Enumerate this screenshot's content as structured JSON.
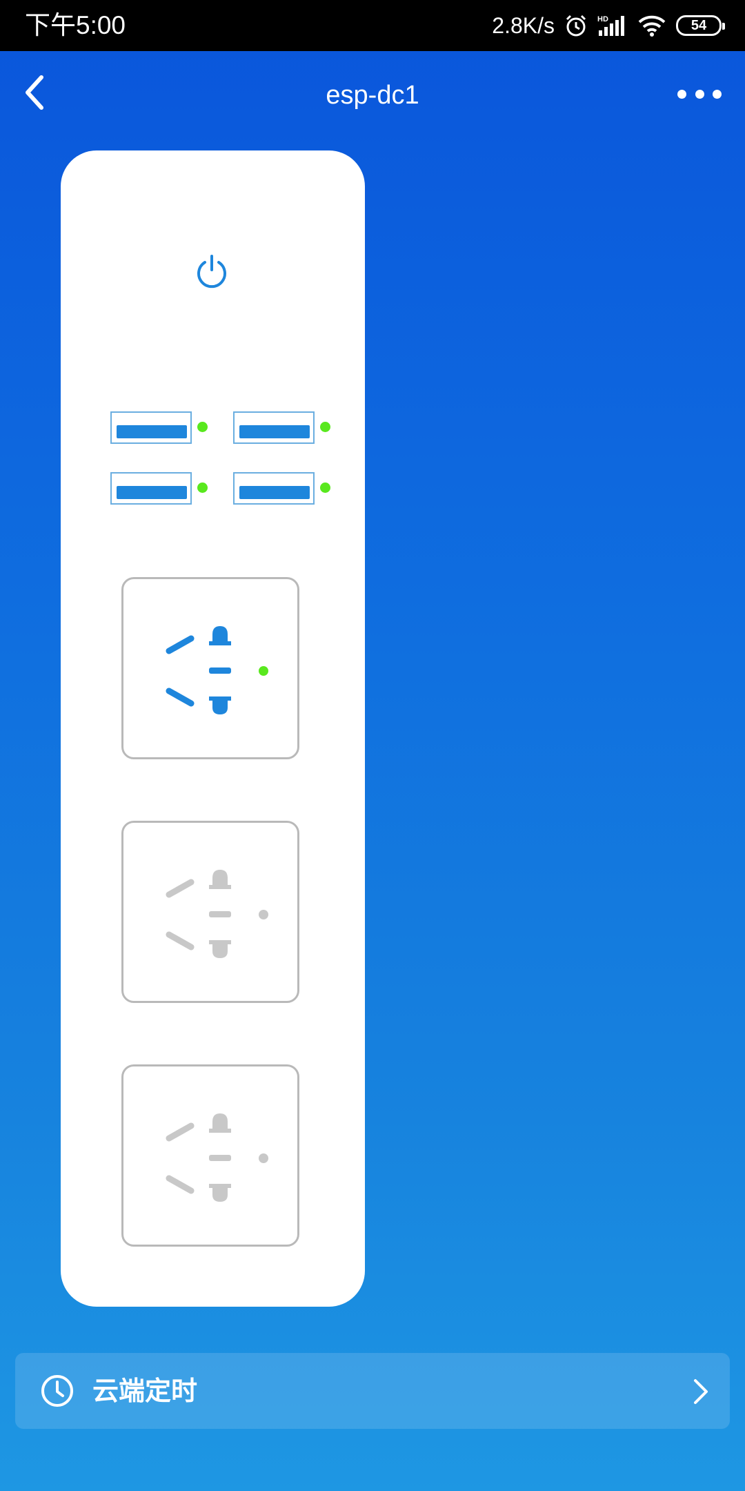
{
  "status_bar": {
    "time": "下午5:00",
    "network_speed": "2.8K/s",
    "battery_level": "54",
    "icons": [
      "alarm-icon",
      "hd-signal-icon",
      "wifi-icon",
      "battery-icon"
    ]
  },
  "header": {
    "title": "esp-dc1",
    "back_icon": "chevron-left-icon",
    "more_icon": "more-dots-icon"
  },
  "power_strip": {
    "power_icon": "power-icon",
    "usb_ports": [
      {
        "indicator": "on"
      },
      {
        "indicator": "on"
      },
      {
        "indicator": "on"
      },
      {
        "indicator": "on"
      }
    ],
    "outlets": [
      {
        "state": "on"
      },
      {
        "state": "off"
      },
      {
        "state": "off"
      }
    ]
  },
  "timer": {
    "label": "云端定时",
    "icon": "clock-icon",
    "arrow_icon": "chevron-right-icon"
  },
  "colors": {
    "active_blue": "#1e86dc",
    "indicator_on": "#59e81e",
    "inactive_gray": "#c8c8c8"
  }
}
